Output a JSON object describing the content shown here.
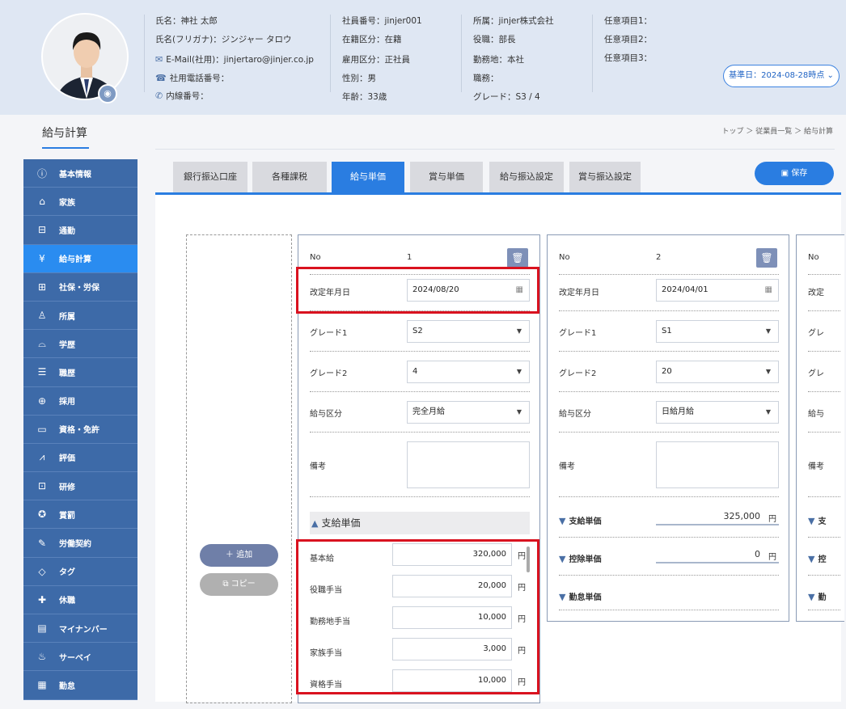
{
  "profile": {
    "name": "氏名：神社 太郎",
    "kana": "氏名(フリガナ)：ジンジャー タロウ",
    "email": "E-Mail(社用)：jinjertaro@jinjer.co.jp",
    "tel": "社用電話番号：",
    "ext": "内線番号：",
    "emp_no": "社員番号：jinjer001",
    "status": "在籍区分：在籍",
    "employ": "雇用区分：正社員",
    "gender": "性別：男",
    "age": "年齢：33歳",
    "company": "所属：jinjer株式会社",
    "position": "役職：部長",
    "workplace": "勤務地：本社",
    "duty": "職務：",
    "grade": "グレード：S3 / 4",
    "opt1": "任意項目1：",
    "opt2": "任意項目2：",
    "opt3": "任意項目3：",
    "kijun": "基準日：2024-08-28時点 ⌄"
  },
  "page": {
    "title": "給与計算",
    "breadcrumb": "トップ ＞ 従業員一覧 ＞ 給与計算",
    "save": "保存"
  },
  "sidebar": [
    {
      "label": "基本情報",
      "icon": "info-icon"
    },
    {
      "label": "家族",
      "icon": "house-icon"
    },
    {
      "label": "通勤",
      "icon": "train-icon"
    },
    {
      "label": "給与計算",
      "icon": "yen-icon",
      "active": true
    },
    {
      "label": "社保・労保",
      "icon": "document-shield-icon"
    },
    {
      "label": "所属",
      "icon": "org-chart-icon"
    },
    {
      "label": "学歴",
      "icon": "graduation-cap-icon"
    },
    {
      "label": "職歴",
      "icon": "resume-icon"
    },
    {
      "label": "採用",
      "icon": "magnifier-icon"
    },
    {
      "label": "資格・免許",
      "icon": "certificate-icon"
    },
    {
      "label": "評価",
      "icon": "compass-icon"
    },
    {
      "label": "研修",
      "icon": "presentation-icon"
    },
    {
      "label": "賞罰",
      "icon": "medal-icon"
    },
    {
      "label": "労働契約",
      "icon": "contract-icon"
    },
    {
      "label": "タグ",
      "icon": "tag-icon"
    },
    {
      "label": "休職",
      "icon": "cross-icon"
    },
    {
      "label": "マイナンバー",
      "icon": "id-card-icon"
    },
    {
      "label": "サーベイ",
      "icon": "survey-icon"
    },
    {
      "label": "勤怠",
      "icon": "attendance-icon"
    }
  ],
  "tabs": [
    "銀行振込口座",
    "各種課税",
    "給与単価",
    "賞与単価",
    "給与振込設定",
    "賞与振込設定"
  ],
  "active_tab": 2,
  "buttons": {
    "add": "＋ 追加",
    "copy": "⧉ コピー"
  },
  "labels": {
    "no": "No",
    "date": "改定年月日",
    "grade1": "グレード1",
    "grade2": "グレード2",
    "kubun": "給与区分",
    "biko": "備考",
    "shikyu": "支給単価",
    "kojo": "控除単価",
    "kintai": "勤怠単価",
    "yen": "円"
  },
  "card1": {
    "no": "1",
    "date": "2024/08/20",
    "grade1": "S2",
    "grade2": "4",
    "kubun": "完全月給",
    "items": [
      {
        "label": "基本給",
        "value": "320,000"
      },
      {
        "label": "役職手当",
        "value": "20,000"
      },
      {
        "label": "勤務地手当",
        "value": "10,000"
      },
      {
        "label": "家族手当",
        "value": "3,000"
      },
      {
        "label": "資格手当",
        "value": "10,000"
      }
    ]
  },
  "card2": {
    "no": "2",
    "date": "2024/04/01",
    "grade1": "S1",
    "grade2": "20",
    "kubun": "日給月給",
    "shikyu_total": "325,000",
    "kojo_total": "0"
  },
  "card3": {
    "no": "No",
    "date": "改定",
    "grade1": "グレ",
    "grade2": "グレ",
    "kubun": "給与",
    "biko": "備考",
    "s": "支",
    "k": "控",
    "ki": "勤"
  }
}
